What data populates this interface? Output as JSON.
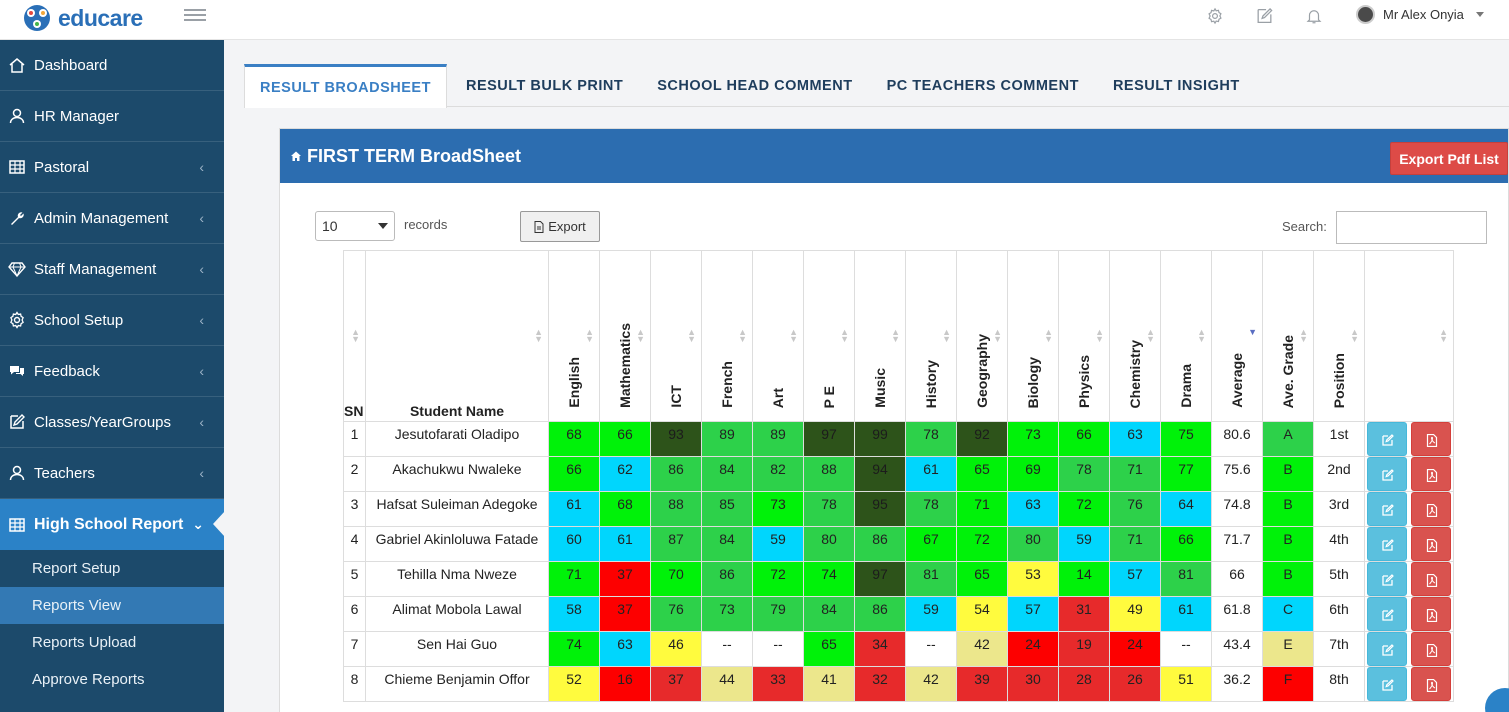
{
  "app": {
    "name": "educare"
  },
  "user": {
    "name": "Mr Alex Onyia"
  },
  "sidebar": {
    "items": [
      {
        "label": "Dashboard",
        "icon": "home-icon",
        "chevron": false
      },
      {
        "label": "HR Manager",
        "icon": "user-icon",
        "chevron": false
      },
      {
        "label": "Pastoral",
        "icon": "table-icon",
        "chevron": true
      },
      {
        "label": "Admin Management",
        "icon": "wrench-icon",
        "chevron": true
      },
      {
        "label": "Staff Management",
        "icon": "diamond-icon",
        "chevron": true
      },
      {
        "label": "School Setup",
        "icon": "gear-icon",
        "chevron": true
      },
      {
        "label": "Feedback",
        "icon": "chat-icon",
        "chevron": true
      },
      {
        "label": "Classes/YearGroups",
        "icon": "edit-icon",
        "chevron": true
      },
      {
        "label": "Teachers",
        "icon": "user-icon",
        "chevron": true
      },
      {
        "label": "High School Report",
        "icon": "table-icon",
        "chevron": true,
        "active": true
      }
    ],
    "subitems": [
      {
        "label": "Report Setup"
      },
      {
        "label": "Reports View",
        "active": true
      },
      {
        "label": "Reports Upload"
      },
      {
        "label": "Approve Reports"
      }
    ]
  },
  "tabs": [
    {
      "label": "RESULT BROADSHEET",
      "active": true
    },
    {
      "label": "RESULT BULK PRINT"
    },
    {
      "label": "SCHOOL HEAD COMMENT"
    },
    {
      "label": "PC TEACHERS COMMENT"
    },
    {
      "label": "RESULT INSIGHT"
    }
  ],
  "panel": {
    "title": "FIRST TERM BroadSheet",
    "export_pdf_label": "Export Pdf List",
    "page_length": "10",
    "records_label": "records",
    "export_label": "Export",
    "search_label": "Search:",
    "search_value": ""
  },
  "table": {
    "sn_header": "SN",
    "name_header": "Student Name",
    "subjects": [
      "English",
      "Mathematics",
      "ICT",
      "French",
      "Art",
      "P E",
      "Music",
      "History",
      "Geography",
      "Biology",
      "Physics",
      "Chemistry",
      "Drama"
    ],
    "summary_headers": [
      "Average",
      "Ave. Grade",
      "Position"
    ],
    "sorted_column": "Average",
    "sort_direction": "desc",
    "grade_colors": {
      "A+": "#2d531a",
      "A": "#2dd14a",
      "B": "#00f209",
      "C": "#00d6fd",
      "D": "#fffb3e",
      "E": "#ece78c",
      "F": "#fd0000",
      "F-": "#e72a2b",
      "none": "#ffffff"
    },
    "rows": [
      {
        "sn": "1",
        "name": "Jesutofarati Oladipo",
        "scores": [
          "68",
          "66",
          "93",
          "89",
          "89",
          "97",
          "99",
          "78",
          "92",
          "73",
          "66",
          "63",
          "75"
        ],
        "grades": [
          "B",
          "B",
          "A+",
          "A",
          "A",
          "A+",
          "A+",
          "A",
          "A+",
          "B",
          "B",
          "C",
          "B"
        ],
        "average": "80.6",
        "ave_grade": "A",
        "ave_grade_color": "A",
        "position": "1st"
      },
      {
        "sn": "2",
        "name": "Akachukwu Nwaleke",
        "scores": [
          "66",
          "62",
          "86",
          "84",
          "82",
          "88",
          "94",
          "61",
          "65",
          "69",
          "78",
          "71",
          "77"
        ],
        "grades": [
          "B",
          "C",
          "A",
          "A",
          "A",
          "A",
          "A+",
          "C",
          "B",
          "B",
          "A",
          "A",
          "B"
        ],
        "average": "75.6",
        "ave_grade": "B",
        "ave_grade_color": "B",
        "position": "2nd"
      },
      {
        "sn": "3",
        "name": "Hafsat Suleiman Adegoke",
        "scores": [
          "61",
          "68",
          "88",
          "85",
          "73",
          "78",
          "95",
          "78",
          "71",
          "63",
          "72",
          "76",
          "64"
        ],
        "grades": [
          "C",
          "B",
          "A",
          "A",
          "B",
          "A",
          "A+",
          "A",
          "B",
          "C",
          "B",
          "A",
          "C"
        ],
        "average": "74.8",
        "ave_grade": "B",
        "ave_grade_color": "B",
        "position": "3rd"
      },
      {
        "sn": "4",
        "name": "Gabriel Akinloluwa Fatade",
        "scores": [
          "60",
          "61",
          "87",
          "84",
          "59",
          "80",
          "86",
          "67",
          "72",
          "80",
          "59",
          "71",
          "66"
        ],
        "grades": [
          "C",
          "C",
          "A",
          "A",
          "C",
          "A",
          "A",
          "B",
          "B",
          "A",
          "C",
          "A",
          "B"
        ],
        "average": "71.7",
        "ave_grade": "B",
        "ave_grade_color": "B",
        "position": "4th"
      },
      {
        "sn": "5",
        "name": "Tehilla Nma Nweze",
        "scores": [
          "71",
          "37",
          "70",
          "86",
          "72",
          "74",
          "97",
          "81",
          "65",
          "53",
          "14",
          "57",
          "81"
        ],
        "grades": [
          "B",
          "F",
          "B",
          "A",
          "B",
          "B",
          "A+",
          "A",
          "B",
          "D",
          "B",
          "C",
          "A"
        ],
        "average": "66",
        "ave_grade": "B",
        "ave_grade_color": "B",
        "position": "5th"
      },
      {
        "sn": "6",
        "name": "Alimat Mobola Lawal",
        "scores": [
          "58",
          "37",
          "76",
          "73",
          "79",
          "84",
          "86",
          "59",
          "54",
          "57",
          "31",
          "49",
          "61"
        ],
        "grades": [
          "C",
          "F",
          "A",
          "A",
          "A",
          "A",
          "A",
          "C",
          "D",
          "C",
          "F-",
          "D",
          "C"
        ],
        "average": "61.8",
        "ave_grade": "C",
        "ave_grade_color": "C",
        "position": "6th"
      },
      {
        "sn": "7",
        "name": "Sen Hai Guo",
        "scores": [
          "74",
          "63",
          "46",
          "--",
          "--",
          "65",
          "34",
          "--",
          "42",
          "24",
          "19",
          "24",
          "--"
        ],
        "grades": [
          "B",
          "C",
          "D",
          "none",
          "none",
          "B",
          "F-",
          "none",
          "E",
          "F",
          "F-",
          "F",
          "none"
        ],
        "average": "43.4",
        "ave_grade": "E",
        "ave_grade_color": "E",
        "position": "7th"
      },
      {
        "sn": "8",
        "name": "Chieme Benjamin Offor",
        "scores": [
          "52",
          "16",
          "37",
          "44",
          "33",
          "41",
          "32",
          "42",
          "39",
          "30",
          "28",
          "26",
          "51"
        ],
        "grades": [
          "D",
          "F",
          "F-",
          "E",
          "F-",
          "E",
          "F-",
          "E",
          "F-",
          "F-",
          "F-",
          "F-",
          "D"
        ],
        "average": "36.2",
        "ave_grade": "F",
        "ave_grade_color": "F",
        "position": "8th"
      }
    ]
  }
}
